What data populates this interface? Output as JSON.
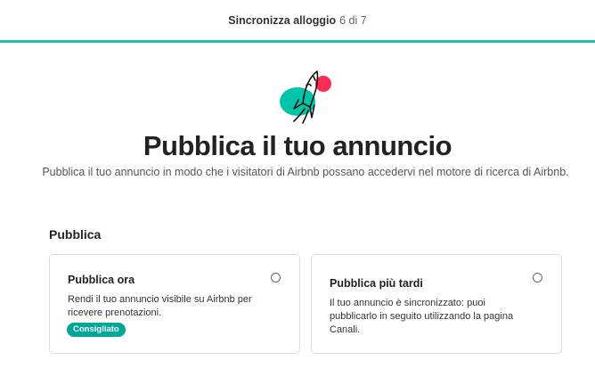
{
  "header": {
    "step_title": "Sincronizza alloggio",
    "step_count": "6 di 7"
  },
  "hero": {
    "icon": "rocket-illustration",
    "title": "Pubblica il tuo annuncio",
    "subtitle": "Pubblica il tuo annuncio in modo che i visitatori di Airbnb possano accedervi nel motore di ricerca di Airbnb."
  },
  "publish": {
    "section_label": "Pubblica",
    "options": [
      {
        "title": "Pubblica ora",
        "description": "Rendi il tuo annuncio visibile su Airbnb per ricevere prenotazioni.",
        "badge": "Consigliato",
        "selected": false
      },
      {
        "title": "Pubblica più tardi",
        "description": "Il tuo annuncio è sincronizzato: puoi pubblicarlo in seguito utilizzando la pagina Canali.",
        "selected": false
      }
    ]
  },
  "colors": {
    "accent": "#1fbfa8",
    "badge": "#00a699",
    "rocket_teal": "#00c4a7",
    "rocket_red": "#ff2d55"
  }
}
